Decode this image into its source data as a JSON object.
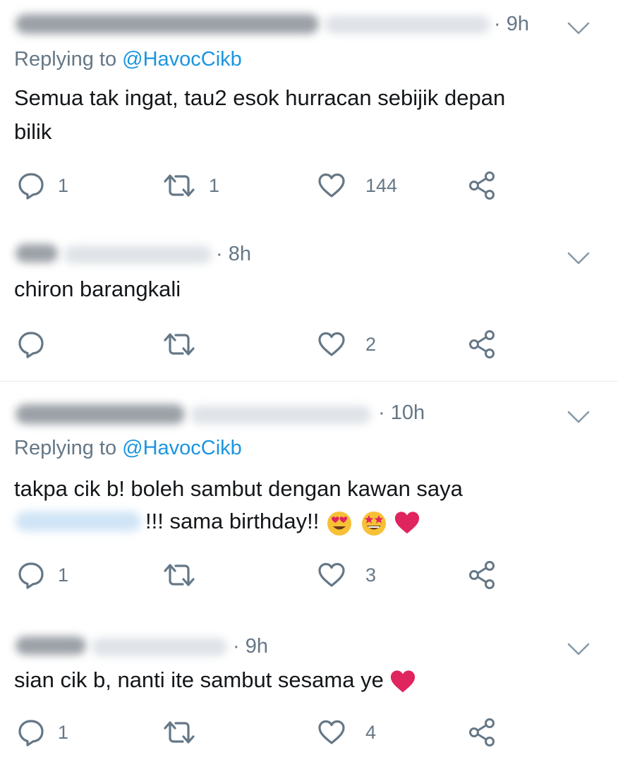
{
  "tweets": [
    {
      "time": "· 9h",
      "replying_prefix": "Replying to ",
      "replying_handle": "@HavocCikb",
      "text_line1": "Semua tak ingat, tau2 esok hurracan sebijik depan",
      "text_line2": "bilik",
      "reply_count": "1",
      "retweet_count": "1",
      "like_count": "144"
    },
    {
      "time": "· 8h",
      "text_line1": "chiron barangkali",
      "reply_count": "",
      "retweet_count": "",
      "like_count": "2"
    },
    {
      "time": "· 10h",
      "replying_prefix": "Replying to ",
      "replying_handle": "@HavocCikb",
      "text_line1": "takpa cik b! boleh sambut dengan kawan saya",
      "text_line2": "!!! sama birthday!!",
      "reply_count": "1",
      "retweet_count": "",
      "like_count": "3"
    },
    {
      "time": "· 9h",
      "text_line1": "sian cik b, nanti ite sambut sesama ye",
      "reply_count": "1",
      "retweet_count": "",
      "like_count": "4"
    }
  ],
  "icons": {
    "reply": "reply-icon",
    "retweet": "retweet-icon",
    "like": "heart-icon",
    "share": "share-icon",
    "menu": "chevron-down-icon"
  },
  "colors": {
    "text": "#14171a",
    "muted": "#657786",
    "link": "#1b95e0",
    "heart": "#e0245e"
  }
}
